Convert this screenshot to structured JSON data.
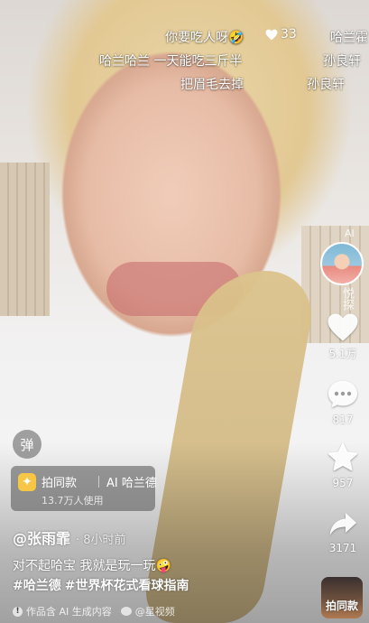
{
  "danmaku": {
    "line1_text": "你要吃人呀",
    "line1_likes": "33",
    "line1_right": "哈兰霍",
    "line2_left": "哈兰哈兰 一天能吃三斤半",
    "line2_right": "孙良轩",
    "line3_left": "把眉毛去掉",
    "line3_right": "孙良轩"
  },
  "sidebar": {
    "avatar_badge": "AI",
    "follow_caption": "悦探",
    "like_count": "5.1万",
    "comment_count": "817",
    "favorite_count": "957",
    "share_count": "3171",
    "same_video_label": "拍同款"
  },
  "danmu_toggle_label": "弹",
  "template": {
    "title": "拍同款",
    "name": "AI 哈兰德",
    "usage": "13.7万人使用"
  },
  "post": {
    "author": "@张雨霏",
    "time": "· 8小时前",
    "caption": "对不起哈宝 我就是玩一玩🤪",
    "tags": [
      "#哈兰德",
      "#世界杯花式看球指南"
    ],
    "footer_ai": "作品含 AI 生成内容",
    "footer_source": "@星视频"
  },
  "colors": {
    "heart": "#ffffff",
    "template_icon": "#f6c644"
  }
}
